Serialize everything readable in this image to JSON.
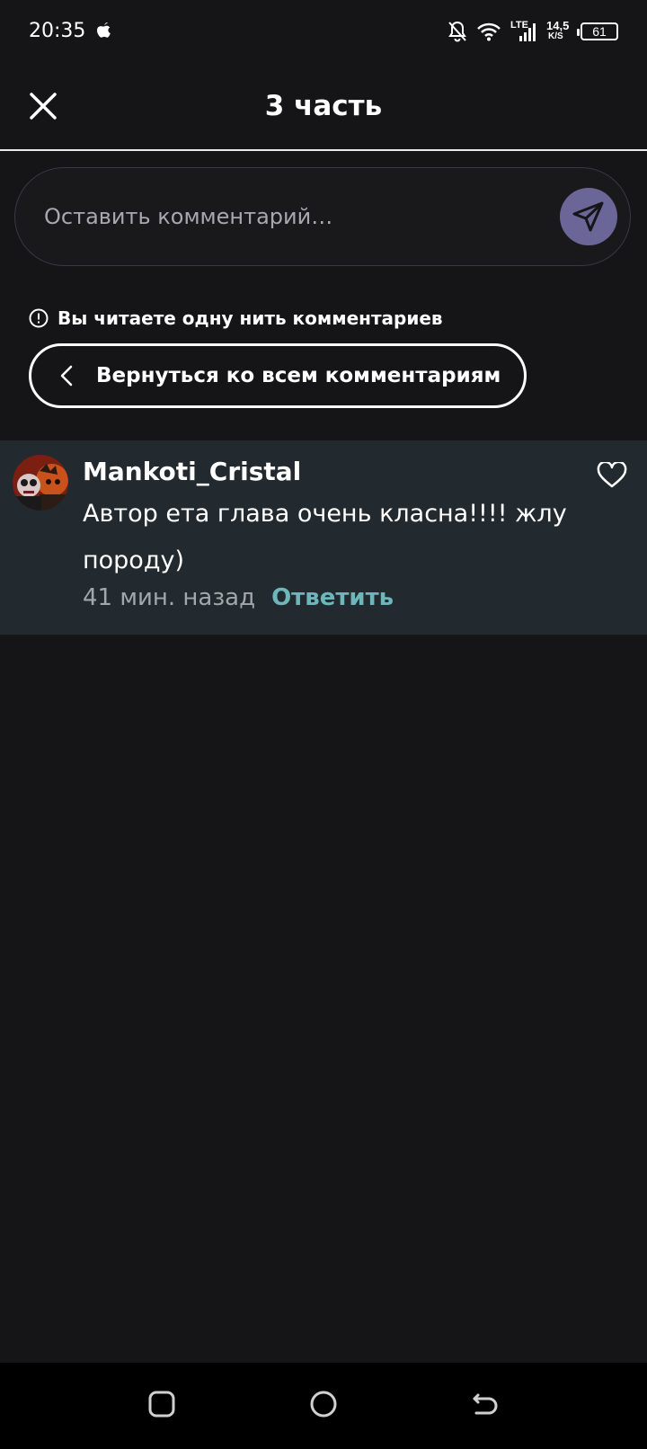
{
  "status_bar": {
    "time": "20:35",
    "network": "LTE",
    "speed_value": "14,5",
    "speed_unit": "K/S",
    "battery": "61"
  },
  "header": {
    "title": "3 часть"
  },
  "comment_input": {
    "placeholder": "Оставить комментарий…"
  },
  "thread": {
    "notice": "Вы читаете одну нить комментариев",
    "back_label": "Вернуться ко всем комментариям"
  },
  "comments": [
    {
      "username": "Mankoti_Cristal",
      "text": "Автор ета глава очень класна!!!! жлу породу)",
      "time": "41 мин. назад",
      "reply_label": "Ответить"
    }
  ],
  "icons": {
    "close": "close-icon",
    "send": "send-icon",
    "info": "info-icon",
    "back": "chevron-left-icon",
    "like": "heart-icon",
    "nav_recent": "square-icon",
    "nav_home": "circle-icon",
    "nav_back": "back-arrow-icon"
  },
  "colors": {
    "background": "#151417",
    "card": "#222a2f",
    "send_button": "#6a6697",
    "reply_link": "#6db6b9"
  }
}
